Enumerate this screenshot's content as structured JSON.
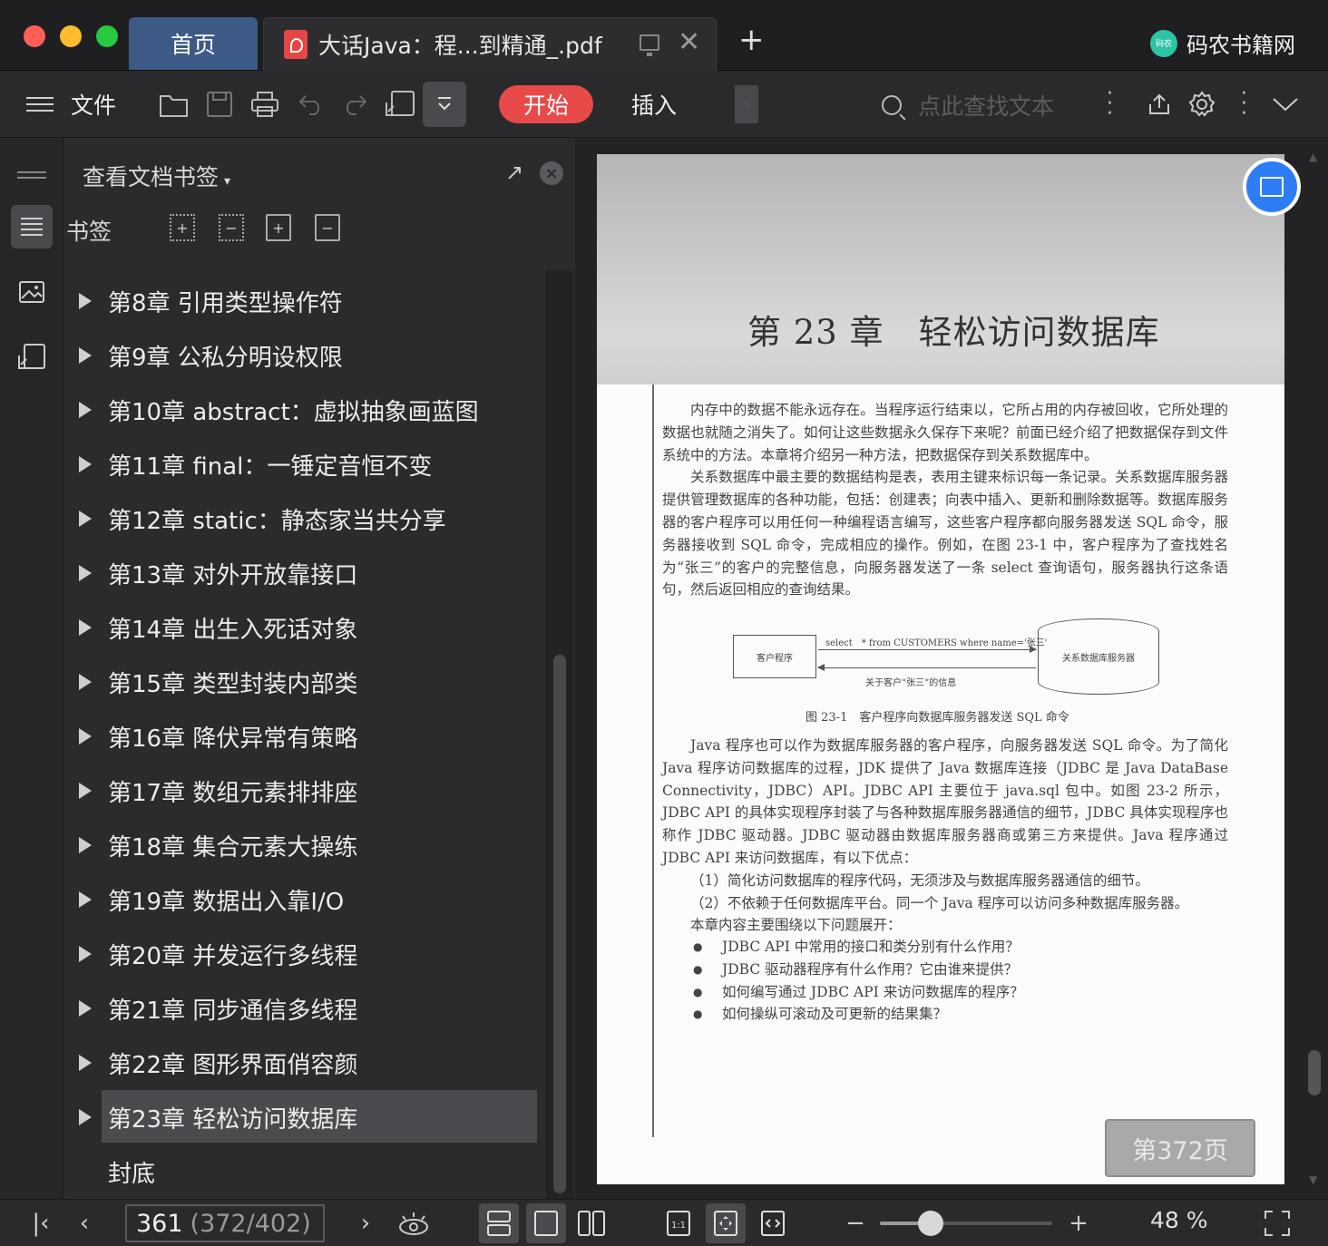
{
  "titlebar": {
    "home_tab": "首页",
    "doc_tab_title": "大话Java：程...到精通_.pdf",
    "close_glyph": "✕",
    "new_tab_glyph": "+",
    "brand_logo_text": "码农",
    "brand_name": "码农书籍网",
    "traffic_lights": [
      "#ff5f57",
      "#febc2e",
      "#28c840"
    ]
  },
  "toolbar": {
    "menu_icon": "hamburger-icon",
    "file_label": "文件",
    "start_label": "开始",
    "insert_label": "插入",
    "search_placeholder": "点此查找文本",
    "accent_color": "#e84a4a"
  },
  "panel": {
    "title": "查看文档书签",
    "caret": "▾",
    "popout_glyph": "↗",
    "close_glyph": "×",
    "bookmarks_label": "书签",
    "tool_glyphs": [
      "+",
      "−",
      "+",
      "−"
    ],
    "items": [
      "第8章 引用类型操作符",
      "第9章 公私分明设权限",
      "第10章 abstract：虚拟抽象画蓝图",
      "第11章 final：一锤定音恒不变",
      "第12章 static：静态家当共分享",
      "第13章 对外开放靠接口",
      "第14章 出生入死话对象",
      "第15章 类型封装内部类",
      "第16章 降伏异常有策略",
      "第17章 数组元素排排座",
      "第18章 集合元素大操练",
      "第19章 数据出入靠I/O",
      "第20章 并发运行多线程",
      "第21章 同步通信多线程",
      "第22章 图形界面俏容颜",
      "第23章 轻松访问数据库"
    ],
    "last_item": "封底",
    "selected_index": 15
  },
  "document": {
    "chapter_title": "第 23 章　轻松访问数据库",
    "paragraphs": [
      "内存中的数据不能永远存在。当程序运行结束以，它所占用的内存被回收，它所处理的数据也就随之消失了。如何让这些数据永久保存下来呢？前面已经介绍了把数据保存到文件系统中的方法。本章将介绍另一种方法，把数据保存到关系数据库中。",
      "关系数据库中最主要的数据结构是表，表用主键来标识每一条记录。关系数据库服务器提供管理数据库的各种功能，包括：创建表；向表中插入、更新和删除数据等。数据库服务器的客户程序可以用任何一种编程语言编写，这些客户程序都向服务器发送 SQL 命令，服务器接收到 SQL 命令，完成相应的操作。例如，在图 23-1 中，客户程序为了查找姓名为“张三”的客户的完整信息，向服务器发送了一条 select 查询语句，服务器执行这条语句，然后返回相应的查询结果。"
    ],
    "figure": {
      "client_label": "客户程序",
      "server_label": "关系数据库服务器",
      "request_label": "select　* from CUSTOMERS where name='张三'",
      "response_label": "关于客户“张三”的信息",
      "caption": "图 23-1　客户程序向数据库服务器发送 SQL 命令"
    },
    "paragraphs2": [
      "Java 程序也可以作为数据库服务器的客户程序，向服务器发送 SQL 命令。为了简化 Java 程序访问数据库的过程，JDK 提供了 Java 数据库连接（JDBC 是 Java DataBase Connectivity，JDBC）API。JDBC API 主要位于 java.sql 包中。如图 23-2 所示，JDBC API 的具体实现程序封装了与各种数据库服务器通信的细节，JDBC 具体实现程序也称作 JDBC 驱动器。JDBC 驱动器由数据库服务器商或第三方来提供。Java 程序通过 JDBC API 来访问数据库，有以下优点：",
      "（1）简化访问数据库的程序代码，无须涉及与数据库服务器通信的细节。",
      "（2）不依赖于任何数据库平台。同一个 Java 程序可以访问多种数据库服务器。",
      "本章内容主要围绕以下问题展开："
    ],
    "bullets": [
      "JDBC API 中常用的接口和类分别有什么作用？",
      "JDBC 驱动器程序有什么作用？它由谁来提供？",
      "如何编写通过 JDBC API 来访问数据库的程序？",
      "如何操纵可滚动及可更新的结果集？"
    ],
    "page_badge": "第372页"
  },
  "statusbar": {
    "first_glyph": "|‹",
    "prev_glyph": "‹",
    "next_glyph": "›",
    "current_page": "361",
    "page_total": "(372/402)",
    "zoom_minus": "−",
    "zoom_plus": "+",
    "zoom_fraction": 0.3,
    "zoom_value": "48 %"
  }
}
